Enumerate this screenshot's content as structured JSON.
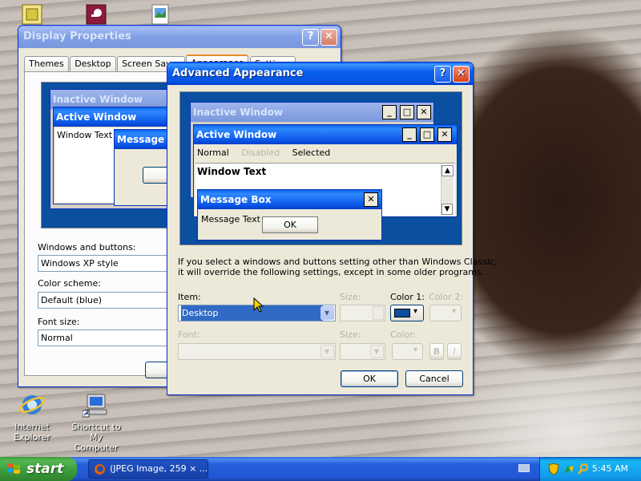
{
  "desktop": {
    "icons": [
      {
        "label": "Internet Explorer",
        "line1": "Internet",
        "line2": "Explorer"
      },
      {
        "label": "Shortcut to My Computer",
        "line1": "Shortcut to My",
        "line2": "Computer"
      }
    ]
  },
  "display_properties": {
    "title": "Display Properties",
    "help_label": "?",
    "close_label": "✕",
    "tabs": [
      "Themes",
      "Desktop",
      "Screen Saver",
      "Appearance",
      "Settings"
    ],
    "preview": {
      "inactive_title": "Inactive Window",
      "active_title": "Active Window",
      "window_text": "Window Text",
      "message_title": "Message"
    },
    "windows_and_buttons_label": "Windows and buttons:",
    "windows_and_buttons_value": "Windows XP style",
    "color_scheme_label": "Color scheme:",
    "color_scheme_value": "Default (blue)",
    "font_size_label": "Font size:",
    "font_size_value": "Normal"
  },
  "advanced": {
    "title": "Advanced Appearance",
    "help_label": "?",
    "close_label": "✕",
    "preview": {
      "inactive_title": "Inactive Window",
      "active_title": "Active Window",
      "menu": [
        "Normal",
        "Disabled",
        "Selected"
      ],
      "window_text": "Window Text",
      "msgbox_title": "Message Box",
      "msgbox_text": "Message Text",
      "msgbox_ok": "OK"
    },
    "info_line1": "If you select a windows and buttons setting other than Windows Classic,",
    "info_line2": "it will override the following settings, except in some older programs.",
    "item_label": "Item:",
    "item_value": "Desktop",
    "size_label": "Size:",
    "color1_label": "Color 1:",
    "color1_value": "#0a4fa0",
    "color2_label": "Color 2:",
    "font_label": "Font:",
    "font_size_label": "Size:",
    "font_color_label": "Color:",
    "bold_label": "B",
    "italic_label": "I",
    "ok_label": "OK",
    "cancel_label": "Cancel"
  },
  "taskbar": {
    "start_label": "start",
    "task_label": "(JPEG Image, 259 × ...",
    "clock": "5:45 AM"
  },
  "colors": {
    "xp_blue": "#0a5fef",
    "start_green": "#3a9a3a",
    "tray_blue": "#139ee9",
    "desktop_color": "#0a4fa0"
  }
}
